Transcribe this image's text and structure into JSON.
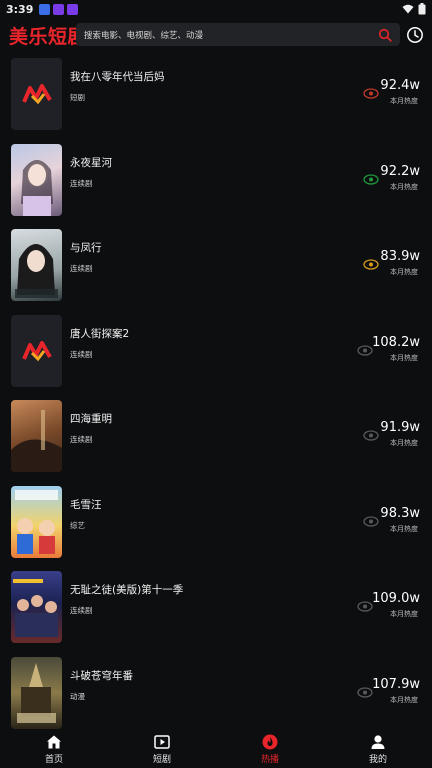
{
  "status_bar": {
    "time": "3:39"
  },
  "header": {
    "logo": "美乐短剧",
    "search_placeholder": "搜索电影、电视剧、综艺、动漫"
  },
  "heat_label": "本月热度",
  "colors": {
    "accent": "#e8252b",
    "eye_red": "#c0392b",
    "eye_green": "#1e9a3b",
    "eye_orange": "#d89a1e",
    "eye_gray": "#5a5a5a"
  },
  "items": [
    {
      "title": "我在八零年代当后妈",
      "genre": "短剧",
      "heat": "92.4w",
      "eye": "eye_red",
      "poster": "logo",
      "icon": "view-count-icon"
    },
    {
      "title": "永夜星河",
      "genre": "连续剧",
      "heat": "92.2w",
      "eye": "eye_green",
      "poster": "photo",
      "icon": "view-count-icon"
    },
    {
      "title": "与凤行",
      "genre": "连续剧",
      "heat": "83.9w",
      "eye": "eye_orange",
      "poster": "photo",
      "icon": "view-count-icon"
    },
    {
      "title": "唐人街探案2",
      "genre": "连续剧",
      "heat": "108.2w",
      "eye": "eye_gray",
      "poster": "logo",
      "icon": "view-count-icon"
    },
    {
      "title": "四海重明",
      "genre": "连续剧",
      "heat": "91.9w",
      "eye": "eye_gray",
      "poster": "photo",
      "icon": "view-count-icon"
    },
    {
      "title": "毛雪汪",
      "genre": "综艺",
      "heat": "98.3w",
      "eye": "eye_gray",
      "poster": "photo",
      "icon": "view-count-icon"
    },
    {
      "title": "无耻之徒(美版)第十一季",
      "genre": "连续剧",
      "heat": "109.0w",
      "eye": "eye_gray",
      "poster": "photo",
      "icon": "view-count-icon"
    },
    {
      "title": "斗破苍穹年番",
      "genre": "动漫",
      "heat": "107.9w",
      "eye": "eye_gray",
      "poster": "photo",
      "icon": "view-count-icon"
    }
  ],
  "nav": [
    {
      "label": "首页",
      "icon": "home-icon",
      "active": false
    },
    {
      "label": "短剧",
      "icon": "play-icon",
      "active": false
    },
    {
      "label": "热播",
      "icon": "flame-icon",
      "active": true
    },
    {
      "label": "我的",
      "icon": "user-icon",
      "active": false
    }
  ]
}
